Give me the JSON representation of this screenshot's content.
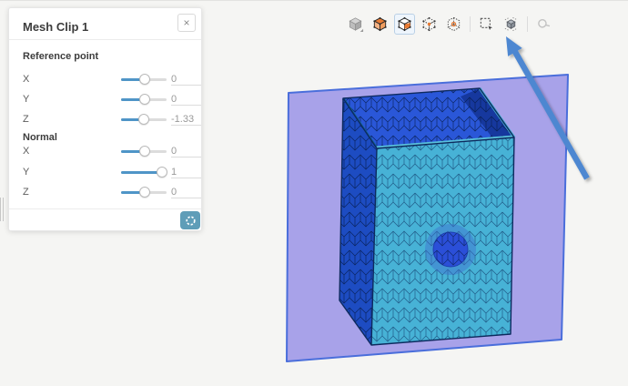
{
  "page": {
    "background": "#f5f5f3"
  },
  "panel": {
    "title": "Mesh Clip 1",
    "close_label": "×",
    "sections": [
      {
        "label": "Reference point",
        "rows": [
          {
            "label": "X",
            "value": "0",
            "pct": 52
          },
          {
            "label": "Y",
            "value": "0",
            "pct": 52
          },
          {
            "label": "Z",
            "value": "-1.33",
            "pct": 50
          }
        ]
      },
      {
        "label": "Normal",
        "rows": [
          {
            "label": "X",
            "value": "0",
            "pct": 52
          },
          {
            "label": "Y",
            "value": "1",
            "pct": 90
          },
          {
            "label": "Z",
            "value": "0",
            "pct": 52
          }
        ]
      }
    ],
    "footer": {
      "update_button_color": "#5f9db8"
    }
  },
  "toolbar": {
    "icons": [
      {
        "name": "solid-view-icon",
        "selected": false
      },
      {
        "name": "mesh-surface-icon",
        "selected": false
      },
      {
        "name": "mesh-wireframe-icon",
        "selected": true
      },
      {
        "name": "mesh-points-icon",
        "selected": false
      },
      {
        "name": "mesh-element-icon",
        "selected": false
      },
      {
        "name": "box-select-icon",
        "selected": false
      },
      {
        "name": "mesh-clip-icon",
        "selected": false
      },
      {
        "name": "zoom-icon",
        "selected": false
      }
    ]
  },
  "scene": {
    "clip_plane_fill": "#a29ce9",
    "clip_plane_edge": "#3c63d9",
    "front_face": "#47b2d6",
    "side_face": "#1d4cc2",
    "interior_face": "#2a57d8",
    "interior_dark": "#16389e",
    "front_rim": "#58c0db",
    "mesh_edge": "#0d2a5e",
    "sphere_fill": "#2b4fd8",
    "sphere_halo": "#3f6fd0",
    "arrow_color": "#4e87d1"
  }
}
